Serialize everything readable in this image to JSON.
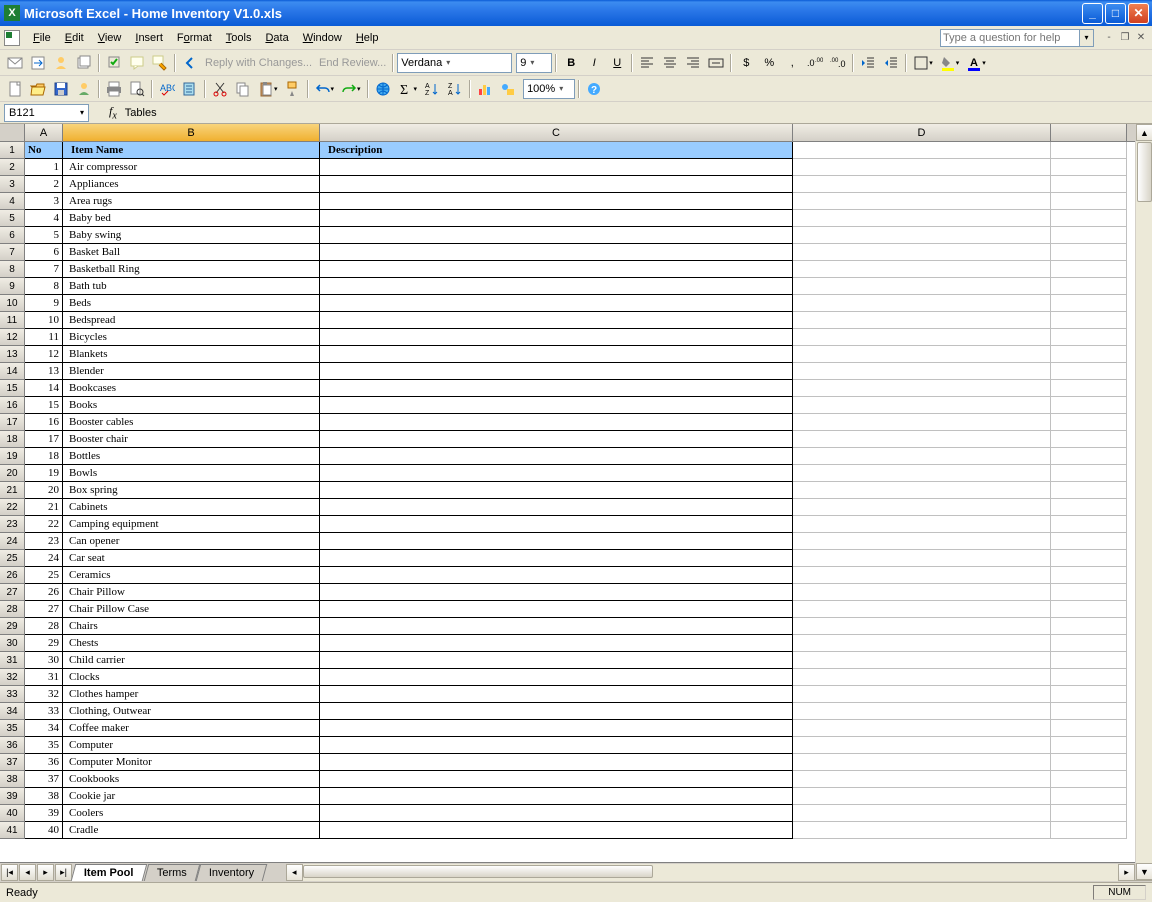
{
  "window": {
    "title": "Microsoft Excel - Home Inventory V1.0.xls"
  },
  "menu": {
    "file": "File",
    "edit": "Edit",
    "view": "View",
    "insert": "Insert",
    "format": "Format",
    "tools": "Tools",
    "data": "Data",
    "window": "Window",
    "help": "Help"
  },
  "help_placeholder": "Type a question for help",
  "toolbar1": {
    "reply": "Reply with Changes...",
    "end": "End Review...",
    "font": "Verdana",
    "size": "9",
    "bold": "B",
    "italic": "I",
    "underline": "U",
    "currency": "$",
    "percent": "%",
    "comma": ",",
    "zoom": "100%"
  },
  "namebox": {
    "ref": "B121",
    "formula": "Tables"
  },
  "columns": [
    "A",
    "B",
    "C",
    "D"
  ],
  "headers": {
    "A": "No",
    "B": "Item Name",
    "C": "Description"
  },
  "rows": [
    {
      "n": 1,
      "name": "Air compressor"
    },
    {
      "n": 2,
      "name": "Appliances"
    },
    {
      "n": 3,
      "name": "Area rugs"
    },
    {
      "n": 4,
      "name": "Baby bed"
    },
    {
      "n": 5,
      "name": "Baby swing"
    },
    {
      "n": 6,
      "name": "Basket Ball"
    },
    {
      "n": 7,
      "name": "Basketball Ring"
    },
    {
      "n": 8,
      "name": "Bath tub"
    },
    {
      "n": 9,
      "name": "Beds"
    },
    {
      "n": 10,
      "name": "Bedspread"
    },
    {
      "n": 11,
      "name": "Bicycles"
    },
    {
      "n": 12,
      "name": "Blankets"
    },
    {
      "n": 13,
      "name": "Blender"
    },
    {
      "n": 14,
      "name": "Bookcases"
    },
    {
      "n": 15,
      "name": "Books"
    },
    {
      "n": 16,
      "name": "Booster cables"
    },
    {
      "n": 17,
      "name": "Booster chair"
    },
    {
      "n": 18,
      "name": "Bottles"
    },
    {
      "n": 19,
      "name": "Bowls"
    },
    {
      "n": 20,
      "name": "Box spring"
    },
    {
      "n": 21,
      "name": "Cabinets"
    },
    {
      "n": 22,
      "name": "Camping equipment"
    },
    {
      "n": 23,
      "name": "Can opener"
    },
    {
      "n": 24,
      "name": "Car seat"
    },
    {
      "n": 25,
      "name": "Ceramics"
    },
    {
      "n": 26,
      "name": "Chair Pillow"
    },
    {
      "n": 27,
      "name": "Chair Pillow Case"
    },
    {
      "n": 28,
      "name": "Chairs"
    },
    {
      "n": 29,
      "name": "Chests"
    },
    {
      "n": 30,
      "name": "Child carrier"
    },
    {
      "n": 31,
      "name": "Clocks"
    },
    {
      "n": 32,
      "name": "Clothes hamper"
    },
    {
      "n": 33,
      "name": "Clothing, Outwear"
    },
    {
      "n": 34,
      "name": "Coffee maker"
    },
    {
      "n": 35,
      "name": "Computer"
    },
    {
      "n": 36,
      "name": "Computer Monitor"
    },
    {
      "n": 37,
      "name": "Cookbooks"
    },
    {
      "n": 38,
      "name": "Cookie jar"
    },
    {
      "n": 39,
      "name": "Coolers"
    },
    {
      "n": 40,
      "name": "Cradle"
    }
  ],
  "tabs": {
    "t1": "Item Pool",
    "t2": "Terms",
    "t3": "Inventory"
  },
  "status": {
    "ready": "Ready",
    "num": "NUM"
  }
}
